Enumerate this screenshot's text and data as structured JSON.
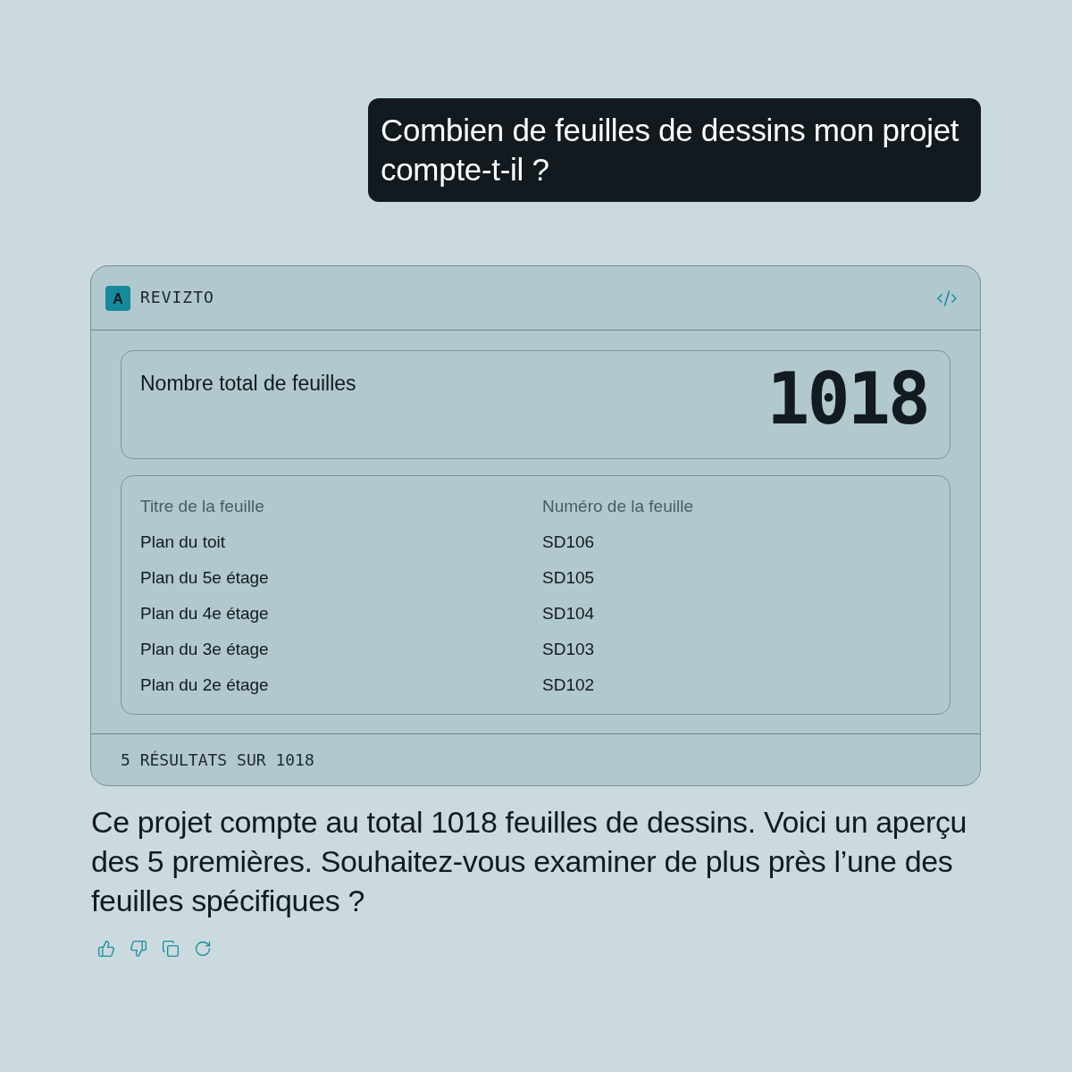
{
  "user_message": {
    "text": "Combien de feuilles de dessins mon projet compte-t-il ?"
  },
  "tool_card": {
    "brand": {
      "logo_letter": "A",
      "name": "REVIZTO"
    },
    "header_actions": [
      {
        "kind": "code"
      }
    ],
    "total": {
      "label": "Nombre total de feuilles",
      "value": "1018"
    },
    "table": {
      "columns": [
        "Titre de la feuille",
        "Numéro de la feuille"
      ],
      "rows": [
        [
          "Plan du toit",
          "SD106"
        ],
        [
          "Plan du 5e étage",
          "SD105"
        ],
        [
          "Plan du 4e étage",
          "SD104"
        ],
        [
          "Plan du 3e étage",
          "SD103"
        ],
        [
          "Plan du 2e étage",
          "SD102"
        ]
      ]
    },
    "footer": "5 RÉSULTATS SUR 1018"
  },
  "answer": "Ce projet compte au total 1018 feuilles de dessins. Voici un aperçu des 5 premières. Souhaitez-vous examiner de plus près l’une des feuilles spécifiques ?",
  "actions": [
    {
      "kind": "like"
    },
    {
      "kind": "dislike"
    },
    {
      "kind": "copy"
    },
    {
      "kind": "regenerate"
    }
  ]
}
